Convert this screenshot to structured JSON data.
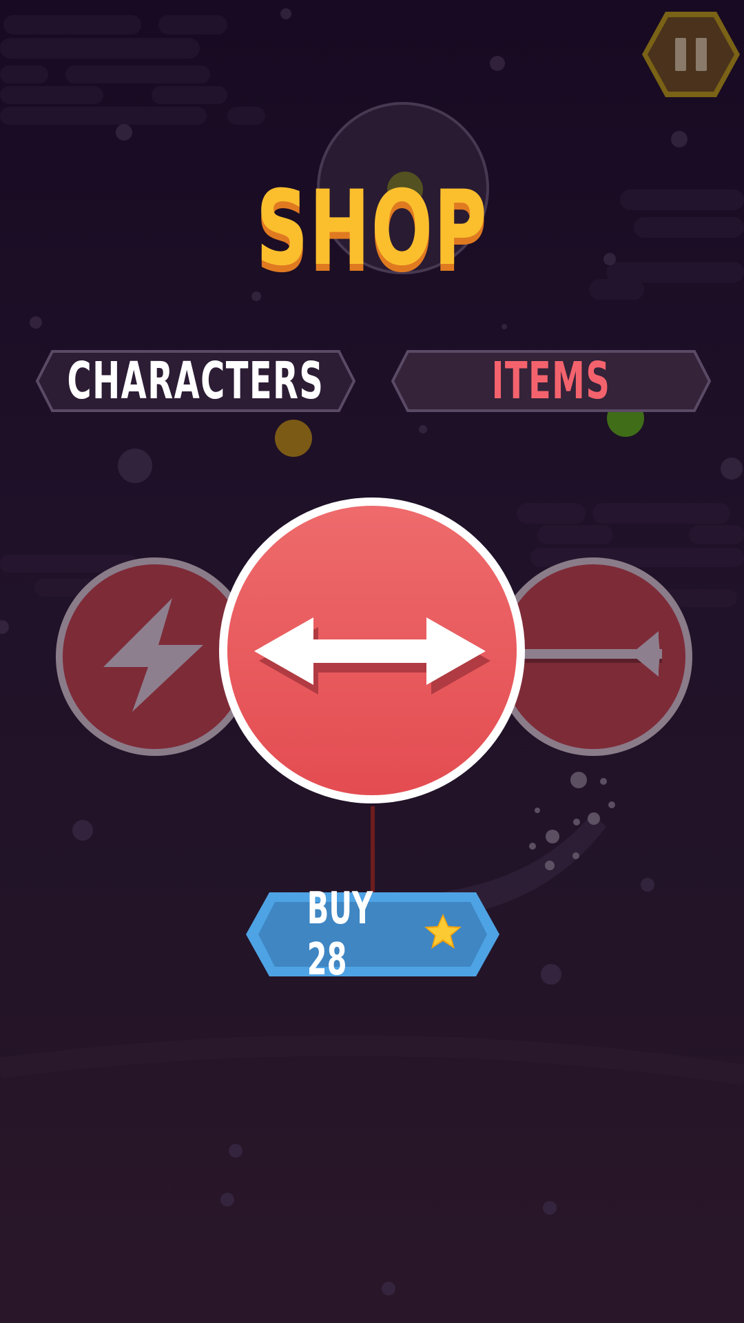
{
  "title": "SHOP",
  "tabs": [
    {
      "label": "CHARACTERS",
      "active": false
    },
    {
      "label": "ITEMS",
      "active": true
    }
  ],
  "items": [
    {
      "name": "lightning",
      "selected": false
    },
    {
      "name": "double-arrow",
      "selected": true
    },
    {
      "name": "arrow",
      "selected": false
    }
  ],
  "buy": {
    "label": "BUY 28",
    "price": 28,
    "currency_icon": "star-icon"
  },
  "colors": {
    "title": "#fbbf2e",
    "title_shadow": "#e07a21",
    "tab_active_text": "#f4636d",
    "tab_text": "#ffffff",
    "item_red": "#ea525a",
    "buy_blue": "#4e9fe0",
    "pause_gold": "#b89320"
  },
  "pause_icon": "pause-icon"
}
